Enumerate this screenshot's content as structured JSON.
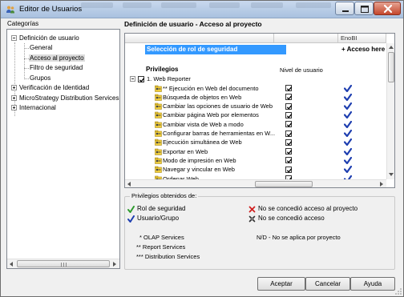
{
  "window": {
    "title": "Editor de Usuarios",
    "icon": "users-icon",
    "controls": [
      "minimize-icon",
      "maximize-icon",
      "close-icon"
    ]
  },
  "sidebar": {
    "label": "Categorías",
    "items": [
      {
        "label": "Definición de usuario",
        "expander": "minus"
      },
      {
        "label": "General"
      },
      {
        "label": "Acceso al proyecto",
        "selected": true
      },
      {
        "label": "Filtro de seguridad"
      },
      {
        "label": "Grupos"
      },
      {
        "label": "Verificación de Identidad",
        "expander": "plus"
      },
      {
        "label": "MicroStrategy Distribution Services",
        "expander": "plus"
      },
      {
        "label": "Internacional",
        "expander": "plus"
      }
    ]
  },
  "main": {
    "section_title": "Definición de usuario - Acceso al proyecto",
    "grid": {
      "column_header_right": "EnoBI",
      "selection_row_label": "Selección de rol de seguridad",
      "selection_row_value": "+ Acceso here",
      "privileges_title": "Privilegios",
      "nivel_label": "Nivel de usuario",
      "group": {
        "label": "1. Web Reporter",
        "expanded": true,
        "checked": true
      },
      "rows": [
        {
          "label": "** Ejecución en Web del documento",
          "checked": true,
          "granted": true
        },
        {
          "label": "Búsqueda de objetos en Web",
          "checked": true,
          "granted": true
        },
        {
          "label": "Cambiar las opciones de usuario de Web",
          "checked": true,
          "granted": true
        },
        {
          "label": "Cambiar página Web por elementos",
          "checked": true,
          "granted": true
        },
        {
          "label": "Cambiar vista de Web a modo",
          "checked": true,
          "granted": true
        },
        {
          "label": "Configurar barras de herramientas en W...",
          "checked": true,
          "granted": true
        },
        {
          "label": "Ejecución simultánea de Web",
          "checked": true,
          "granted": true
        },
        {
          "label": "Exportar en Web",
          "checked": true,
          "granted": true
        },
        {
          "label": "Modo de impresión en Web",
          "checked": true,
          "granted": true
        },
        {
          "label": "Navegar y vincular en Web",
          "checked": true,
          "granted": true
        },
        {
          "label": "Ordenar Web",
          "checked": true,
          "granted": true
        }
      ]
    },
    "legend": {
      "title": "Privilegios obtenidos de:",
      "role_label": "Rol de seguridad",
      "usergroup_label": "Usuario/Grupo",
      "denied_role_label": "No se concedió acceso al proyecto",
      "denied_label": "No se concedió acceso",
      "notes_left": [
        "* OLAP Services",
        "** Report Services",
        "*** Distribution Services"
      ],
      "note_right": "N/D - No se aplica por proyecto",
      "colors": {
        "green": "#2e9b2e",
        "blue": "#1f3fb0",
        "red": "#d02020"
      }
    }
  },
  "buttons": {
    "ok": "Aceptar",
    "cancel": "Cancelar",
    "help": "Ayuda"
  }
}
